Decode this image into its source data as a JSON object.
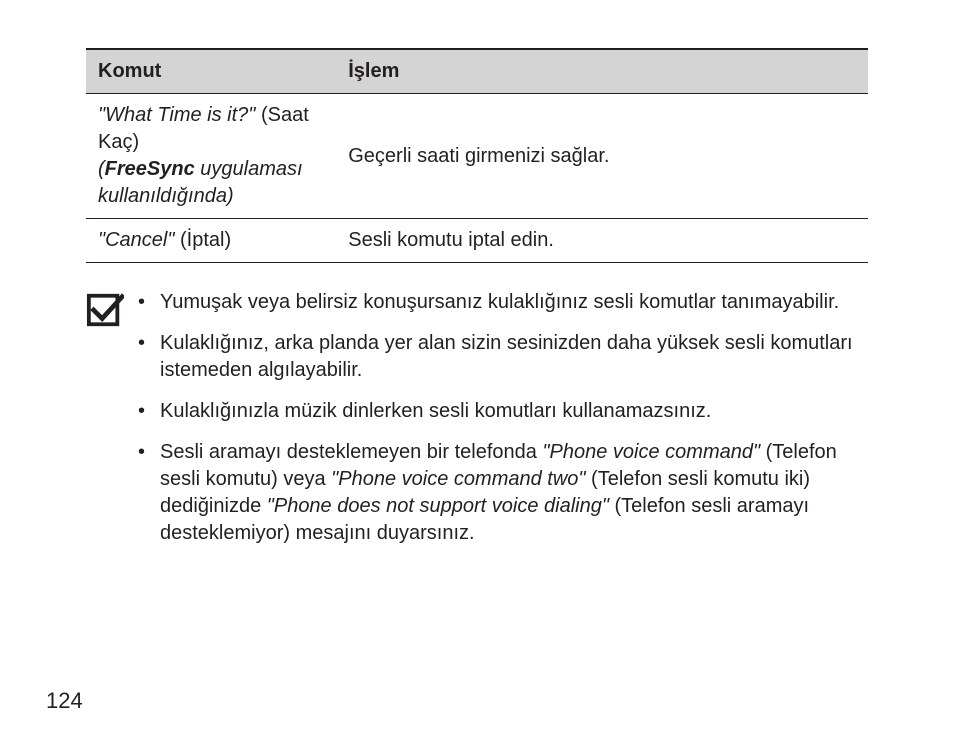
{
  "table": {
    "headers": {
      "command": "Komut",
      "action": "İşlem"
    },
    "rows": [
      {
        "command_parts": {
          "quote": "\"What Time is it?\"",
          "translation": " (Saat Kaç)",
          "freesync_open": " (",
          "freesync_bold": "FreeSync",
          "freesync_rest": " uygulaması kullanıldığında)"
        },
        "action": "Geçerli saati girmenizi sağlar."
      },
      {
        "command_parts": {
          "quote": "\"Cancel\"",
          "translation": " (İptal)"
        },
        "action": "Sesli komutu iptal edin."
      }
    ]
  },
  "notes": {
    "item1": "Yumuşak veya belirsiz konuşursanız kulaklığınız sesli komutlar tanımayabilir.",
    "item2": "Kulaklığınız, arka planda yer alan sizin sesinizden daha yüksek sesli komutları istemeden algılayabilir.",
    "item3": "Kulaklığınızla müzik dinlerken sesli komutları kullanamazsınız.",
    "item4_parts": {
      "a": "Sesli aramayı desteklemeyen bir telefonda ",
      "b": "\"Phone voice command\"",
      "c": " (Telefon sesli komutu) veya ",
      "d": "\"Phone voice command two\"",
      "e": " (Telefon sesli komutu iki) dediğinizde ",
      "f": "\"Phone does not support voice dialing\"",
      "g": " (Telefon sesli aramayı desteklemiyor) mesajını duyarsınız."
    }
  },
  "page_number": "124"
}
